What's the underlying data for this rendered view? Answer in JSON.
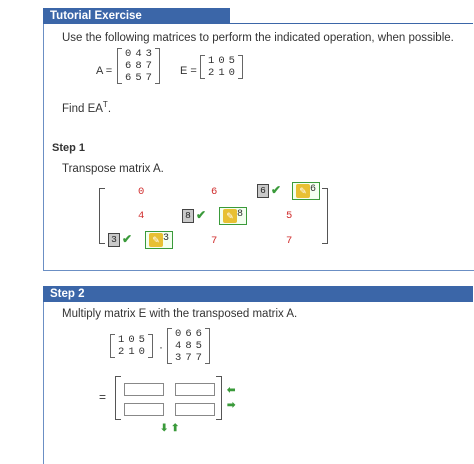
{
  "tutorial": {
    "header": "Tutorial Exercise",
    "instruction": "Use the following matrices to perform the indicated operation, when possible.",
    "a_label": "A =",
    "e_label": "E =",
    "matrix_a": [
      [
        "0",
        "4",
        "3"
      ],
      [
        "6",
        "8",
        "7"
      ],
      [
        "6",
        "5",
        "7"
      ]
    ],
    "matrix_e": [
      [
        "1",
        "0",
        "5"
      ],
      [
        "2",
        "1",
        "0"
      ]
    ],
    "find": "Find EA",
    "find_sup": "T",
    "find_end": "."
  },
  "step1": {
    "title": "Step 1",
    "text": "Transpose matrix A.",
    "row1": {
      "c1": "0",
      "c2": "6",
      "given": "6",
      "answer": "6"
    },
    "row2": {
      "c1": "4",
      "given": "8",
      "answer": "8",
      "c3": "5"
    },
    "row3": {
      "given": "3",
      "answer": "3",
      "c2": "7",
      "c3": "7"
    }
  },
  "step2": {
    "header": "Step 2",
    "text": "Multiply matrix E with the transposed matrix A.",
    "matrix_e": [
      [
        "1",
        "0",
        "5"
      ],
      [
        "2",
        "1",
        "0"
      ]
    ],
    "dot": "·",
    "matrix_at": [
      [
        "0",
        "6",
        "6"
      ],
      [
        "4",
        "8",
        "5"
      ],
      [
        "3",
        "7",
        "7"
      ]
    ],
    "equals": "="
  }
}
